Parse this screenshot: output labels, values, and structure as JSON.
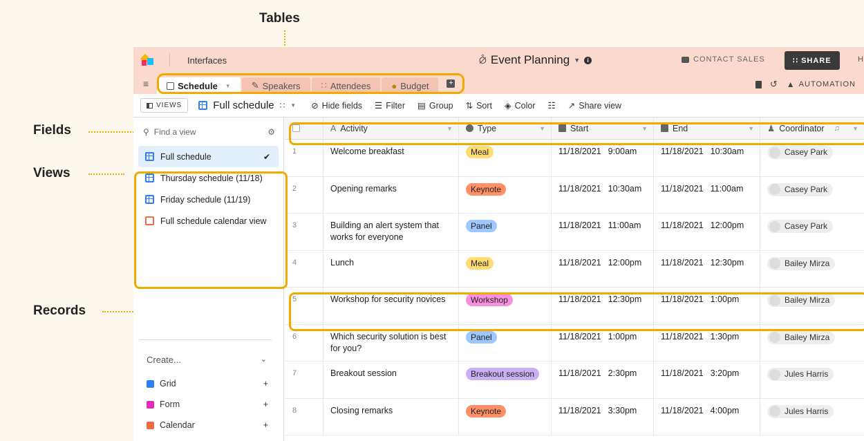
{
  "annotations": {
    "tables": "Tables",
    "fields": "Fields",
    "views": "Views",
    "records": "Records"
  },
  "topbar": {
    "interfaces": "Interfaces",
    "base_title": "Event Planning",
    "contact_sales": "CONTACT SALES",
    "share": "SHARE",
    "help": "H"
  },
  "tabs": [
    {
      "label": "Schedule",
      "icon": "calendar-icon"
    },
    {
      "label": "Speakers",
      "icon": "pen-icon"
    },
    {
      "label": "Attendees",
      "icon": "people-icon"
    },
    {
      "label": "Budget",
      "icon": "money-bag-icon"
    }
  ],
  "tab_right": {
    "automations": "AUTOMATION"
  },
  "viewbar": {
    "views_button": "VIEWS",
    "current_view": "Full schedule",
    "hide_fields": "Hide fields",
    "filter": "Filter",
    "group": "Group",
    "sort": "Sort",
    "color": "Color",
    "share_view": "Share view"
  },
  "sidebar": {
    "find_placeholder": "Find a view",
    "views": [
      {
        "label": "Full schedule",
        "type": "grid",
        "selected": true
      },
      {
        "label": "Thursday schedule (11/18)",
        "type": "grid"
      },
      {
        "label": "Friday schedule (11/19)",
        "type": "grid"
      },
      {
        "label": "Full schedule calendar view",
        "type": "calendar"
      }
    ],
    "create_label": "Create...",
    "create_items": [
      {
        "label": "Grid",
        "color": "#2d7ff9"
      },
      {
        "label": "Form",
        "color": "#e929ba"
      },
      {
        "label": "Calendar",
        "color": "#f06a3f"
      }
    ]
  },
  "grid": {
    "columns": [
      "Activity",
      "Type",
      "Start",
      "End",
      "Coordinator"
    ],
    "rows": [
      {
        "num": "1",
        "activity": "Welcome breakfast",
        "type": "Meal",
        "start_date": "11/18/2021",
        "start_time": "9:00am",
        "end_date": "11/18/2021",
        "end_time": "10:30am",
        "coordinator": "Casey Park"
      },
      {
        "num": "2",
        "activity": "Opening remarks",
        "type": "Keynote",
        "start_date": "11/18/2021",
        "start_time": "10:30am",
        "end_date": "11/18/2021",
        "end_time": "11:00am",
        "coordinator": "Casey Park"
      },
      {
        "num": "3",
        "activity": "Building an alert system that works for everyone",
        "type": "Panel",
        "start_date": "11/18/2021",
        "start_time": "11:00am",
        "end_date": "11/18/2021",
        "end_time": "12:00pm",
        "coordinator": "Casey Park"
      },
      {
        "num": "4",
        "activity": "Lunch",
        "type": "Meal",
        "start_date": "11/18/2021",
        "start_time": "12:00pm",
        "end_date": "11/18/2021",
        "end_time": "12:30pm",
        "coordinator": "Bailey Mirza"
      },
      {
        "num": "5",
        "activity": "Workshop for security novices",
        "type": "Workshop",
        "start_date": "11/18/2021",
        "start_time": "12:30pm",
        "end_date": "11/18/2021",
        "end_time": "1:00pm",
        "coordinator": "Bailey Mirza"
      },
      {
        "num": "6",
        "activity": "Which security solution is best for you?",
        "type": "Panel",
        "start_date": "11/18/2021",
        "start_time": "1:00pm",
        "end_date": "11/18/2021",
        "end_time": "1:30pm",
        "coordinator": "Bailey Mirza"
      },
      {
        "num": "7",
        "activity": "Breakout session",
        "type": "Breakout session",
        "start_date": "11/18/2021",
        "start_time": "2:30pm",
        "end_date": "11/18/2021",
        "end_time": "3:20pm",
        "coordinator": "Jules Harris"
      },
      {
        "num": "8",
        "activity": "Closing remarks",
        "type": "Keynote",
        "start_date": "11/18/2021",
        "start_time": "3:30pm",
        "end_date": "11/18/2021",
        "end_time": "4:00pm",
        "coordinator": "Jules Harris"
      }
    ]
  },
  "type_colors": {
    "Meal": "#ffdc73",
    "Keynote": "#ff8f66",
    "Panel": "#9cc7ff",
    "Workshop": "#f98fe0",
    "Breakout session": "#c9b0f5"
  },
  "highlight_color": "#f2a900"
}
